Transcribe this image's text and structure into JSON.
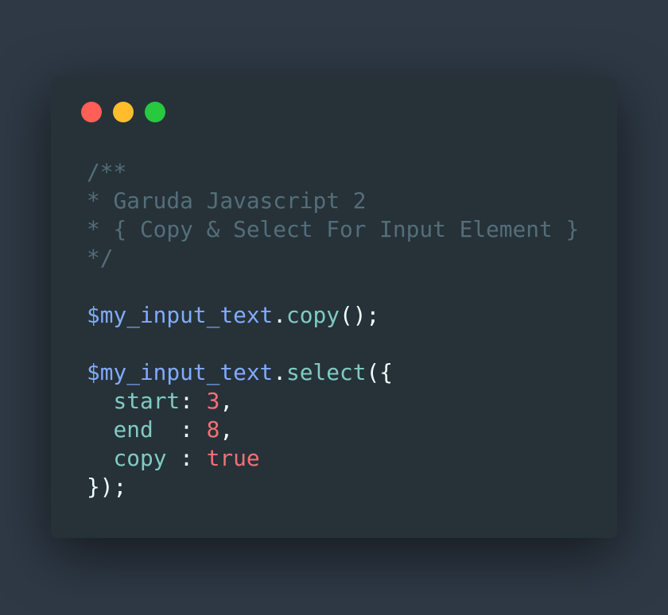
{
  "window": {
    "controls": [
      {
        "name": "close",
        "color": "#ff5f56"
      },
      {
        "name": "minimize",
        "color": "#ffbd2e"
      },
      {
        "name": "maximize",
        "color": "#27c93f"
      }
    ]
  },
  "code": {
    "comment": {
      "l1": "/**",
      "l2": "* Garuda Javascript 2",
      "l3": "* { Copy & Select For Input Element }",
      "l4": "*/"
    },
    "copy_call": {
      "var": "$my_input_text",
      "dot": ".",
      "method": "copy",
      "rest": "();"
    },
    "select_call": {
      "var": "$my_input_text",
      "dot": ".",
      "method": "select",
      "open": "({",
      "start_key": "start",
      "start_sep": ": ",
      "start_val": "3",
      "start_comma": ",",
      "end_key": "end",
      "end_sep": "  : ",
      "end_val": "8",
      "end_comma": ",",
      "copy_key": "copy",
      "copy_sep": " : ",
      "copy_val": "true",
      "close": "});"
    }
  }
}
